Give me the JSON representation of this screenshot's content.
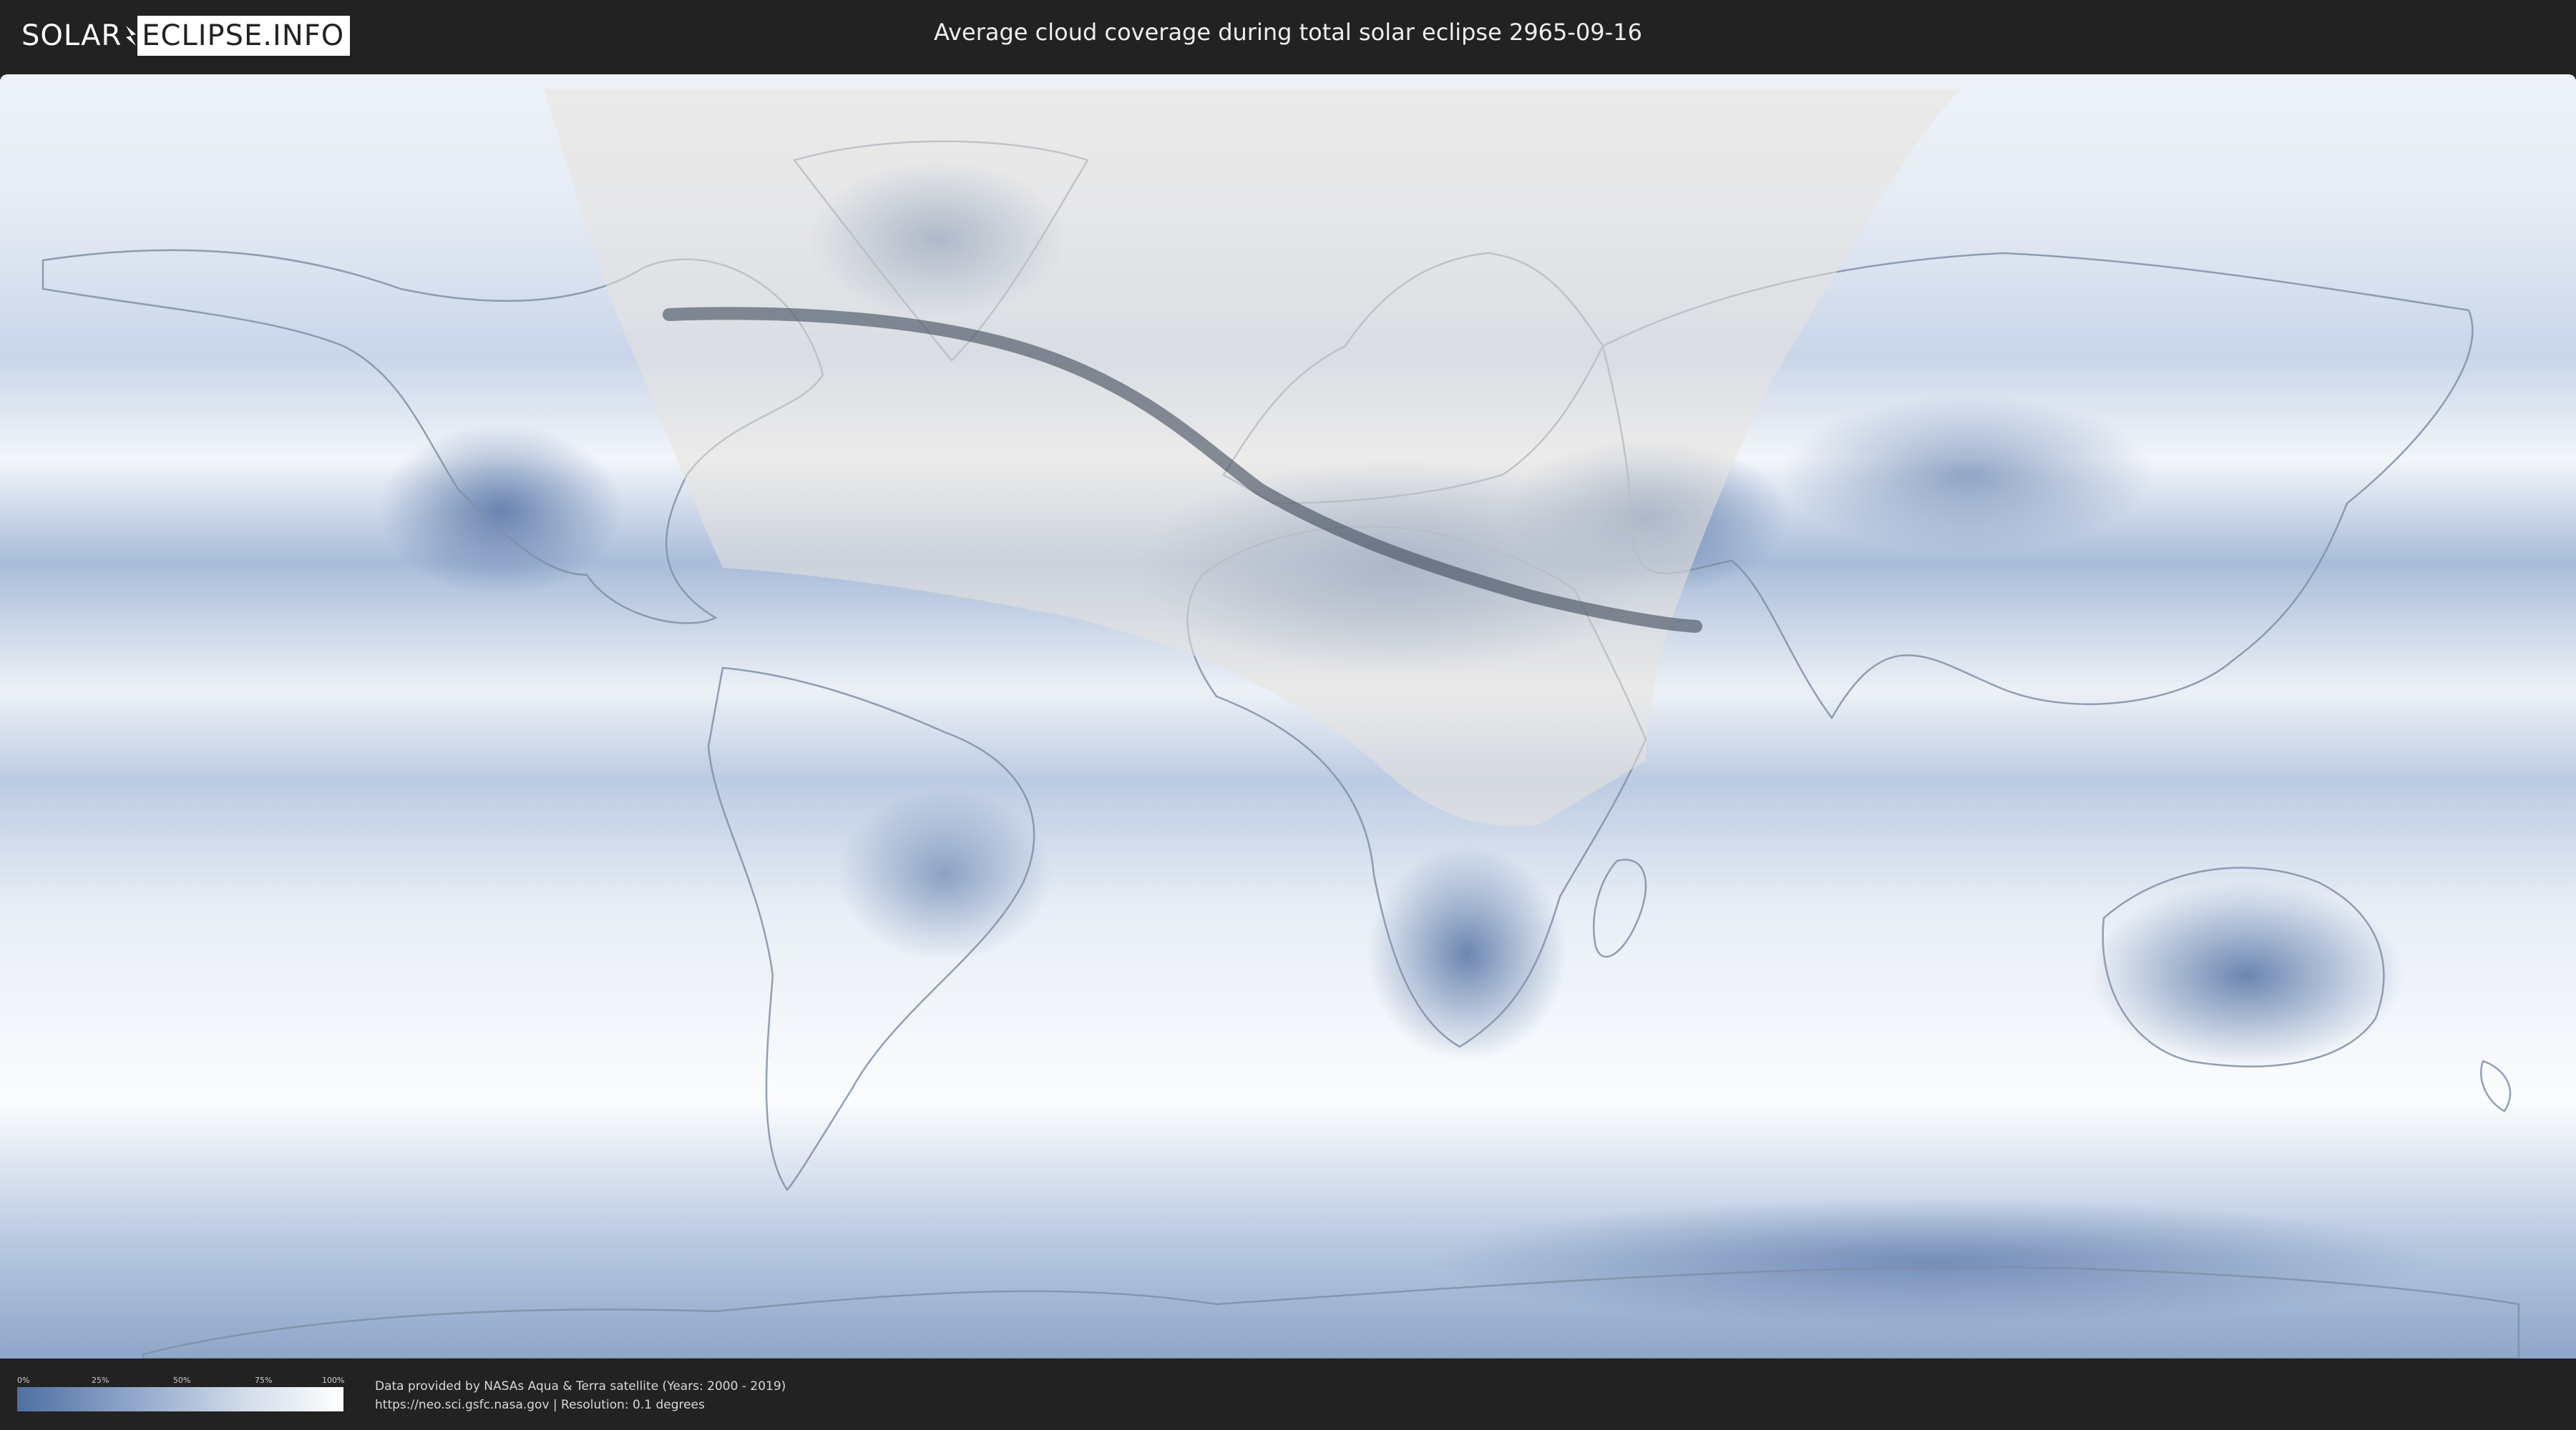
{
  "brand": {
    "logo_left": "SOLAR",
    "logo_right": "ECLIPSE.INFO"
  },
  "title": "Average cloud coverage during total solar eclipse 2965-09-16",
  "legend": {
    "ticks": [
      "0%",
      "25%",
      "50%",
      "75%",
      "100%"
    ],
    "gradient_colors": [
      "#4f6fa3",
      "#8fa6c9",
      "#d2dcea",
      "#ffffff"
    ]
  },
  "credits": {
    "line1": "Data provided by NASAs Aqua & Terra satellite (Years: 2000 - 2019)",
    "line2": "https://neo.sci.gsfc.nasa.gov | Resolution: 0.1 degrees"
  },
  "map": {
    "projection": "equirectangular",
    "colors": {
      "clouds": "#f4f7fb",
      "clear_sky": "#6f8dbb",
      "land_outline": "#7f8fa6",
      "visibility_zone": "#e8e4de",
      "totality_path": "#3f4a5a"
    }
  }
}
